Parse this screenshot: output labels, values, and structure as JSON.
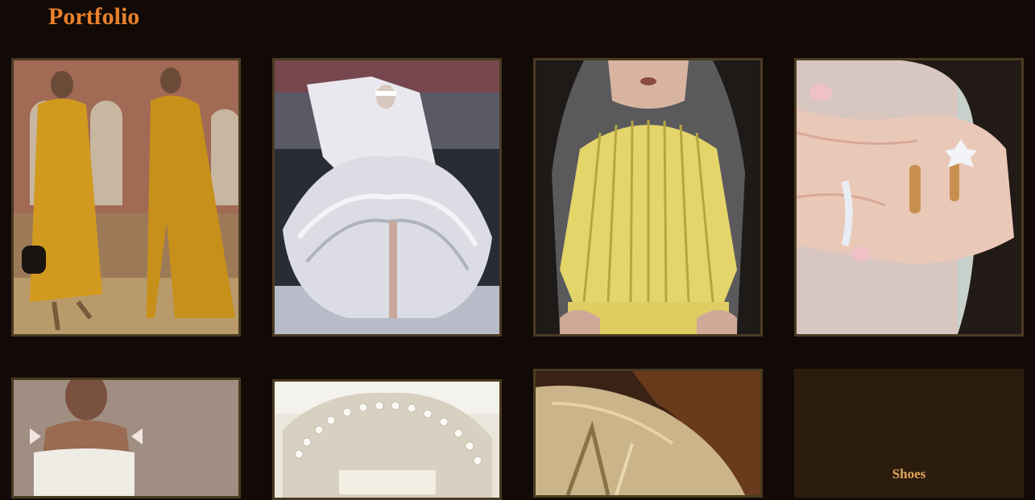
{
  "page": {
    "title": "Portfolio"
  },
  "gallery": {
    "items": [
      {
        "name": "yellow-outfits-photo",
        "kind": "image"
      },
      {
        "name": "white-sculptural-gown-photo",
        "kind": "image"
      },
      {
        "name": "yellow-pleated-top-photo",
        "kind": "image"
      },
      {
        "name": "diamond-rings-hand-photo",
        "kind": "image"
      },
      {
        "name": "white-bow-top-photo",
        "kind": "image"
      },
      {
        "name": "pearl-collar-photo",
        "kind": "image"
      },
      {
        "name": "gold-fabric-photo",
        "kind": "image"
      },
      {
        "name": "shoes-tile",
        "kind": "category",
        "label": "Shoes"
      }
    ]
  }
}
